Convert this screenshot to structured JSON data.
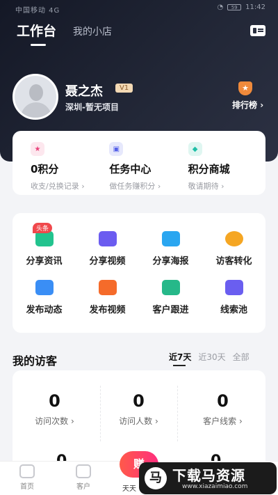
{
  "status_bar": {
    "left": "中国移动 4G",
    "time": "11:42",
    "battery": "59"
  },
  "top_tabs": [
    {
      "label": "工作台",
      "active": true
    },
    {
      "label": "我的小店",
      "active": false
    }
  ],
  "profile": {
    "name": "聂之杰",
    "level": "V1",
    "project": "深圳-暂无项目",
    "rank_label": "排行榜"
  },
  "points": [
    {
      "title": "0积分",
      "sub": "收支/兑换记录",
      "icon": "star-icon",
      "color": "#e8417a"
    },
    {
      "title": "任务中心",
      "sub": "做任务赚积分",
      "icon": "task-icon",
      "color": "#5560e8"
    },
    {
      "title": "积分商城",
      "sub": "敬请期待",
      "icon": "shop-icon",
      "color": "#1fbfa7"
    }
  ],
  "tools": [
    {
      "label": "分享资讯",
      "icon": "article-icon",
      "color": "#22c38e"
    },
    {
      "label": "分享视频",
      "icon": "video-icon",
      "color": "#6b5cf0"
    },
    {
      "label": "分享海报",
      "icon": "poster-icon",
      "color": "#2aa6f0"
    },
    {
      "label": "访客转化",
      "icon": "visitor-icon",
      "color": "#f5a623"
    },
    {
      "label": "发布动态",
      "icon": "folder-icon",
      "color": "#3a8ef5"
    },
    {
      "label": "发布视频",
      "icon": "play-icon",
      "color": "#f56b2a"
    },
    {
      "label": "客户跟进",
      "icon": "follow-icon",
      "color": "#26b889"
    },
    {
      "label": "线索池",
      "icon": "cards-icon",
      "color": "#6a5ef0"
    }
  ],
  "tools_badge": "头条",
  "visitors": {
    "title": "我的访客",
    "filters": [
      {
        "label": "近7天",
        "active": true
      },
      {
        "label": "近30天",
        "active": false
      },
      {
        "label": "全部",
        "active": false
      }
    ],
    "stats": [
      {
        "num": "0",
        "label": "访问次数"
      },
      {
        "num": "0",
        "label": "访问人数"
      },
      {
        "num": "0",
        "label": "客户线索"
      }
    ],
    "row2": [
      "0",
      "0"
    ]
  },
  "bottom_nav": [
    {
      "label": "首页"
    },
    {
      "label": "客户"
    },
    {
      "label": "天天"
    }
  ],
  "fab_label": "赚",
  "watermark": {
    "logo": "马",
    "title": "下载马资源",
    "url": "www.xiazaimiao.com"
  }
}
